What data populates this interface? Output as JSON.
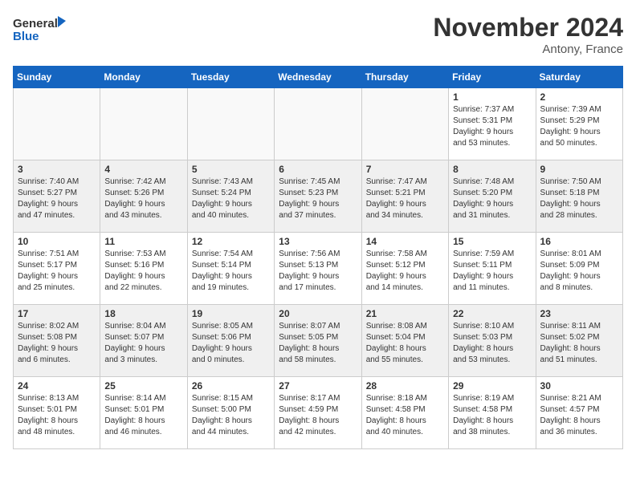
{
  "header": {
    "logo_line1": "General",
    "logo_line2": "Blue",
    "month": "November 2024",
    "location": "Antony, France"
  },
  "weekdays": [
    "Sunday",
    "Monday",
    "Tuesday",
    "Wednesday",
    "Thursday",
    "Friday",
    "Saturday"
  ],
  "weeks": [
    [
      {
        "day": "",
        "info": ""
      },
      {
        "day": "",
        "info": ""
      },
      {
        "day": "",
        "info": ""
      },
      {
        "day": "",
        "info": ""
      },
      {
        "day": "",
        "info": ""
      },
      {
        "day": "1",
        "info": "Sunrise: 7:37 AM\nSunset: 5:31 PM\nDaylight: 9 hours\nand 53 minutes."
      },
      {
        "day": "2",
        "info": "Sunrise: 7:39 AM\nSunset: 5:29 PM\nDaylight: 9 hours\nand 50 minutes."
      }
    ],
    [
      {
        "day": "3",
        "info": "Sunrise: 7:40 AM\nSunset: 5:27 PM\nDaylight: 9 hours\nand 47 minutes."
      },
      {
        "day": "4",
        "info": "Sunrise: 7:42 AM\nSunset: 5:26 PM\nDaylight: 9 hours\nand 43 minutes."
      },
      {
        "day": "5",
        "info": "Sunrise: 7:43 AM\nSunset: 5:24 PM\nDaylight: 9 hours\nand 40 minutes."
      },
      {
        "day": "6",
        "info": "Sunrise: 7:45 AM\nSunset: 5:23 PM\nDaylight: 9 hours\nand 37 minutes."
      },
      {
        "day": "7",
        "info": "Sunrise: 7:47 AM\nSunset: 5:21 PM\nDaylight: 9 hours\nand 34 minutes."
      },
      {
        "day": "8",
        "info": "Sunrise: 7:48 AM\nSunset: 5:20 PM\nDaylight: 9 hours\nand 31 minutes."
      },
      {
        "day": "9",
        "info": "Sunrise: 7:50 AM\nSunset: 5:18 PM\nDaylight: 9 hours\nand 28 minutes."
      }
    ],
    [
      {
        "day": "10",
        "info": "Sunrise: 7:51 AM\nSunset: 5:17 PM\nDaylight: 9 hours\nand 25 minutes."
      },
      {
        "day": "11",
        "info": "Sunrise: 7:53 AM\nSunset: 5:16 PM\nDaylight: 9 hours\nand 22 minutes."
      },
      {
        "day": "12",
        "info": "Sunrise: 7:54 AM\nSunset: 5:14 PM\nDaylight: 9 hours\nand 19 minutes."
      },
      {
        "day": "13",
        "info": "Sunrise: 7:56 AM\nSunset: 5:13 PM\nDaylight: 9 hours\nand 17 minutes."
      },
      {
        "day": "14",
        "info": "Sunrise: 7:58 AM\nSunset: 5:12 PM\nDaylight: 9 hours\nand 14 minutes."
      },
      {
        "day": "15",
        "info": "Sunrise: 7:59 AM\nSunset: 5:11 PM\nDaylight: 9 hours\nand 11 minutes."
      },
      {
        "day": "16",
        "info": "Sunrise: 8:01 AM\nSunset: 5:09 PM\nDaylight: 9 hours\nand 8 minutes."
      }
    ],
    [
      {
        "day": "17",
        "info": "Sunrise: 8:02 AM\nSunset: 5:08 PM\nDaylight: 9 hours\nand 6 minutes."
      },
      {
        "day": "18",
        "info": "Sunrise: 8:04 AM\nSunset: 5:07 PM\nDaylight: 9 hours\nand 3 minutes."
      },
      {
        "day": "19",
        "info": "Sunrise: 8:05 AM\nSunset: 5:06 PM\nDaylight: 9 hours\nand 0 minutes."
      },
      {
        "day": "20",
        "info": "Sunrise: 8:07 AM\nSunset: 5:05 PM\nDaylight: 8 hours\nand 58 minutes."
      },
      {
        "day": "21",
        "info": "Sunrise: 8:08 AM\nSunset: 5:04 PM\nDaylight: 8 hours\nand 55 minutes."
      },
      {
        "day": "22",
        "info": "Sunrise: 8:10 AM\nSunset: 5:03 PM\nDaylight: 8 hours\nand 53 minutes."
      },
      {
        "day": "23",
        "info": "Sunrise: 8:11 AM\nSunset: 5:02 PM\nDaylight: 8 hours\nand 51 minutes."
      }
    ],
    [
      {
        "day": "24",
        "info": "Sunrise: 8:13 AM\nSunset: 5:01 PM\nDaylight: 8 hours\nand 48 minutes."
      },
      {
        "day": "25",
        "info": "Sunrise: 8:14 AM\nSunset: 5:01 PM\nDaylight: 8 hours\nand 46 minutes."
      },
      {
        "day": "26",
        "info": "Sunrise: 8:15 AM\nSunset: 5:00 PM\nDaylight: 8 hours\nand 44 minutes."
      },
      {
        "day": "27",
        "info": "Sunrise: 8:17 AM\nSunset: 4:59 PM\nDaylight: 8 hours\nand 42 minutes."
      },
      {
        "day": "28",
        "info": "Sunrise: 8:18 AM\nSunset: 4:58 PM\nDaylight: 8 hours\nand 40 minutes."
      },
      {
        "day": "29",
        "info": "Sunrise: 8:19 AM\nSunset: 4:58 PM\nDaylight: 8 hours\nand 38 minutes."
      },
      {
        "day": "30",
        "info": "Sunrise: 8:21 AM\nSunset: 4:57 PM\nDaylight: 8 hours\nand 36 minutes."
      }
    ]
  ]
}
